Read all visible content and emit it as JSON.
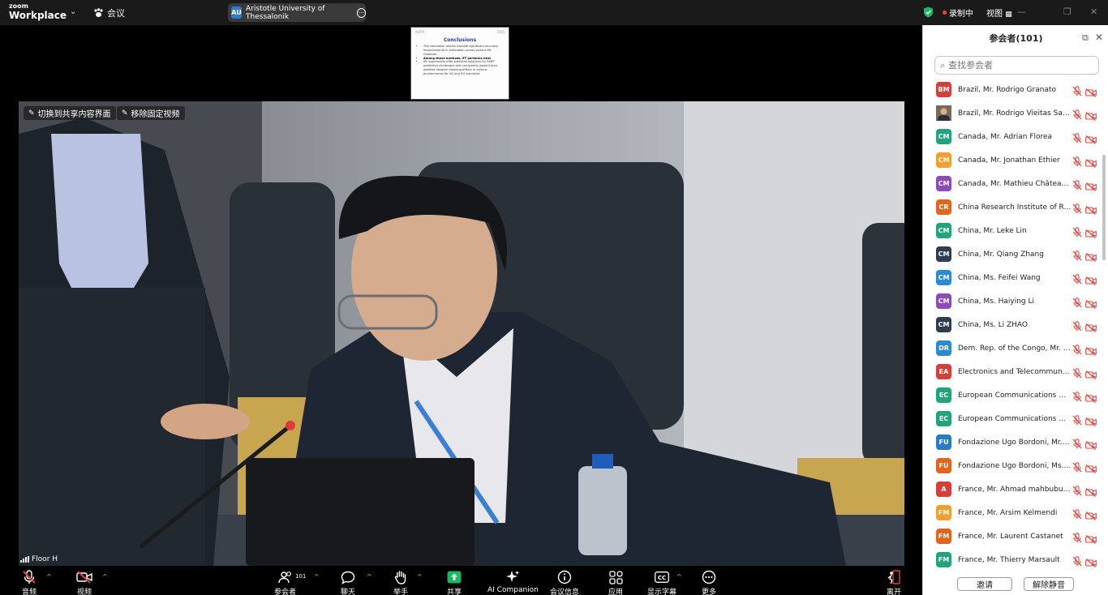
{
  "app": {
    "brand_top": "zoom",
    "brand_bottom": "Workplace",
    "meeting_label": "会议"
  },
  "org_tag": {
    "initials": "AU",
    "name": "Aristotle University of Thessalonik"
  },
  "status": {
    "recording": "录制中",
    "view": "视图"
  },
  "share": {
    "header_left": "AUTH",
    "header_right": "5/45",
    "title": "Conclusions",
    "bullets": [
      {
        "text": "The simulation results indicate significant accuracy improvements in estimation across various ML methods",
        "bold": false
      },
      {
        "text": "Among these methods, ET performs best",
        "bold": true
      },
      {
        "text": "ML approaches offer potential solutions for RSRP prediction challenges and can greatly assist future wireless network planning efforts in various environments for 4G and 5G scenarios",
        "bold": false
      }
    ]
  },
  "video": {
    "pin_switch": "切换到共享内容界面",
    "pin_remove": "移除固定视频",
    "speaker_label": "Floor H"
  },
  "toolbar": {
    "audio": "音频",
    "video": "视频",
    "participants": "参会者",
    "participants_count": "101",
    "chat": "聊天",
    "raise_hand": "举手",
    "share": "共享",
    "ai": "AI Companion",
    "info": "会议信息",
    "apps": "应用",
    "captions": "显示字幕",
    "more": "更多",
    "leave": "离开"
  },
  "panel": {
    "title": "参会者(101)",
    "search_placeholder": "查找参会者",
    "invite": "邀请",
    "unmute_all": "解除静音",
    "participants": [
      {
        "initials": "BM",
        "color": "#d1403a",
        "name": "Brazil, Mr. Rodrigo Granato"
      },
      {
        "initials": "",
        "color": "#8a5a3c",
        "photo": true,
        "name": "Brazil, Mr. Rodrigo Vieitas Sarr..."
      },
      {
        "initials": "CM",
        "color": "#23a37a",
        "name": "Canada, Mr. Adrian Florea"
      },
      {
        "initials": "CM",
        "color": "#f0a030",
        "name": "Canada, Mr. Jonathan Ethier"
      },
      {
        "initials": "CM",
        "color": "#8b4bb8",
        "name": "Canada, Mr. Mathieu Châteauv..."
      },
      {
        "initials": "CR",
        "color": "#e0651e",
        "name": "China Research Institute of Rad..."
      },
      {
        "initials": "CM",
        "color": "#23a37a",
        "name": "China, Mr. Leke Lin"
      },
      {
        "initials": "CM",
        "color": "#2f3d4f",
        "name": "China, Mr. Qiang Zhang"
      },
      {
        "initials": "CM",
        "color": "#2b8ad0",
        "name": "China, Ms. Feifei Wang"
      },
      {
        "initials": "CM",
        "color": "#8b4bb8",
        "name": "China, Ms. Haiying Li"
      },
      {
        "initials": "CM",
        "color": "#2f3d4f",
        "name": "China, Ms. Li ZHAO"
      },
      {
        "initials": "DR",
        "color": "#2b8ad0",
        "name": "Dem. Rep. of the Congo, Mr. K..."
      },
      {
        "initials": "EA",
        "color": "#d1403a",
        "name": "Electronics and Telecommunica..."
      },
      {
        "initials": "EC",
        "color": "#23a37a",
        "name": "European Communications Offi..."
      },
      {
        "initials": "EC",
        "color": "#23a37a",
        "name": "European Communications Offi..."
      },
      {
        "initials": "FU",
        "color": "#2b7bc4",
        "name": "Fondazione Ugo Bordoni, Mr. ..."
      },
      {
        "initials": "FU",
        "color": "#e0651e",
        "name": "Fondazione Ugo Bordoni, Ms. ..."
      },
      {
        "initials": "A",
        "color": "#d1403a",
        "name": "France, Mr. Ahmad mahbubul a..."
      },
      {
        "initials": "FM",
        "color": "#f0a030",
        "name": "France, Mr. Arsim Kelmendi"
      },
      {
        "initials": "FM",
        "color": "#e0651e",
        "name": "France, Mr. Laurent Castanet"
      },
      {
        "initials": "FM",
        "color": "#23a37a",
        "name": "France, Mr. Thierry Marsault"
      }
    ]
  },
  "colors": {
    "accent_green": "#18b85f",
    "mute_red": "#e5413a",
    "panel_bg": "#ffffff",
    "toolbar_bg": "#000000"
  }
}
